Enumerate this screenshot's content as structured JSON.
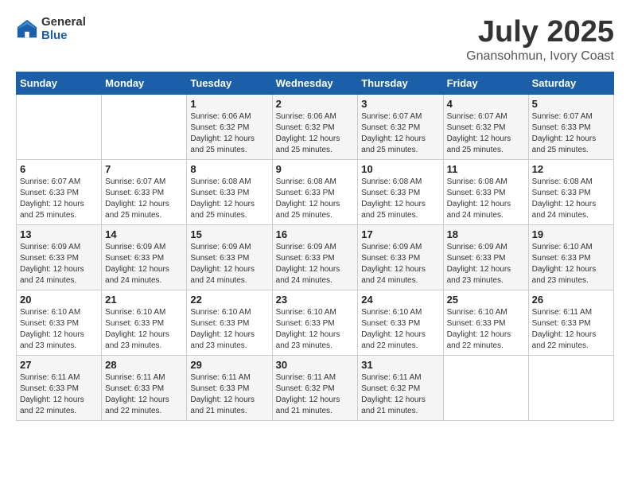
{
  "logo": {
    "general": "General",
    "blue": "Blue"
  },
  "header": {
    "title": "July 2025",
    "subtitle": "Gnansohmun, Ivory Coast"
  },
  "weekdays": [
    "Sunday",
    "Monday",
    "Tuesday",
    "Wednesday",
    "Thursday",
    "Friday",
    "Saturday"
  ],
  "weeks": [
    [
      {
        "day": "",
        "info": ""
      },
      {
        "day": "",
        "info": ""
      },
      {
        "day": "1",
        "info": "Sunrise: 6:06 AM\nSunset: 6:32 PM\nDaylight: 12 hours and 25 minutes."
      },
      {
        "day": "2",
        "info": "Sunrise: 6:06 AM\nSunset: 6:32 PM\nDaylight: 12 hours and 25 minutes."
      },
      {
        "day": "3",
        "info": "Sunrise: 6:07 AM\nSunset: 6:32 PM\nDaylight: 12 hours and 25 minutes."
      },
      {
        "day": "4",
        "info": "Sunrise: 6:07 AM\nSunset: 6:32 PM\nDaylight: 12 hours and 25 minutes."
      },
      {
        "day": "5",
        "info": "Sunrise: 6:07 AM\nSunset: 6:33 PM\nDaylight: 12 hours and 25 minutes."
      }
    ],
    [
      {
        "day": "6",
        "info": "Sunrise: 6:07 AM\nSunset: 6:33 PM\nDaylight: 12 hours and 25 minutes."
      },
      {
        "day": "7",
        "info": "Sunrise: 6:07 AM\nSunset: 6:33 PM\nDaylight: 12 hours and 25 minutes."
      },
      {
        "day": "8",
        "info": "Sunrise: 6:08 AM\nSunset: 6:33 PM\nDaylight: 12 hours and 25 minutes."
      },
      {
        "day": "9",
        "info": "Sunrise: 6:08 AM\nSunset: 6:33 PM\nDaylight: 12 hours and 25 minutes."
      },
      {
        "day": "10",
        "info": "Sunrise: 6:08 AM\nSunset: 6:33 PM\nDaylight: 12 hours and 25 minutes."
      },
      {
        "day": "11",
        "info": "Sunrise: 6:08 AM\nSunset: 6:33 PM\nDaylight: 12 hours and 24 minutes."
      },
      {
        "day": "12",
        "info": "Sunrise: 6:08 AM\nSunset: 6:33 PM\nDaylight: 12 hours and 24 minutes."
      }
    ],
    [
      {
        "day": "13",
        "info": "Sunrise: 6:09 AM\nSunset: 6:33 PM\nDaylight: 12 hours and 24 minutes."
      },
      {
        "day": "14",
        "info": "Sunrise: 6:09 AM\nSunset: 6:33 PM\nDaylight: 12 hours and 24 minutes."
      },
      {
        "day": "15",
        "info": "Sunrise: 6:09 AM\nSunset: 6:33 PM\nDaylight: 12 hours and 24 minutes."
      },
      {
        "day": "16",
        "info": "Sunrise: 6:09 AM\nSunset: 6:33 PM\nDaylight: 12 hours and 24 minutes."
      },
      {
        "day": "17",
        "info": "Sunrise: 6:09 AM\nSunset: 6:33 PM\nDaylight: 12 hours and 24 minutes."
      },
      {
        "day": "18",
        "info": "Sunrise: 6:09 AM\nSunset: 6:33 PM\nDaylight: 12 hours and 23 minutes."
      },
      {
        "day": "19",
        "info": "Sunrise: 6:10 AM\nSunset: 6:33 PM\nDaylight: 12 hours and 23 minutes."
      }
    ],
    [
      {
        "day": "20",
        "info": "Sunrise: 6:10 AM\nSunset: 6:33 PM\nDaylight: 12 hours and 23 minutes."
      },
      {
        "day": "21",
        "info": "Sunrise: 6:10 AM\nSunset: 6:33 PM\nDaylight: 12 hours and 23 minutes."
      },
      {
        "day": "22",
        "info": "Sunrise: 6:10 AM\nSunset: 6:33 PM\nDaylight: 12 hours and 23 minutes."
      },
      {
        "day": "23",
        "info": "Sunrise: 6:10 AM\nSunset: 6:33 PM\nDaylight: 12 hours and 23 minutes."
      },
      {
        "day": "24",
        "info": "Sunrise: 6:10 AM\nSunset: 6:33 PM\nDaylight: 12 hours and 22 minutes."
      },
      {
        "day": "25",
        "info": "Sunrise: 6:10 AM\nSunset: 6:33 PM\nDaylight: 12 hours and 22 minutes."
      },
      {
        "day": "26",
        "info": "Sunrise: 6:11 AM\nSunset: 6:33 PM\nDaylight: 12 hours and 22 minutes."
      }
    ],
    [
      {
        "day": "27",
        "info": "Sunrise: 6:11 AM\nSunset: 6:33 PM\nDaylight: 12 hours and 22 minutes."
      },
      {
        "day": "28",
        "info": "Sunrise: 6:11 AM\nSunset: 6:33 PM\nDaylight: 12 hours and 22 minutes."
      },
      {
        "day": "29",
        "info": "Sunrise: 6:11 AM\nSunset: 6:33 PM\nDaylight: 12 hours and 21 minutes."
      },
      {
        "day": "30",
        "info": "Sunrise: 6:11 AM\nSunset: 6:32 PM\nDaylight: 12 hours and 21 minutes."
      },
      {
        "day": "31",
        "info": "Sunrise: 6:11 AM\nSunset: 6:32 PM\nDaylight: 12 hours and 21 minutes."
      },
      {
        "day": "",
        "info": ""
      },
      {
        "day": "",
        "info": ""
      }
    ]
  ]
}
